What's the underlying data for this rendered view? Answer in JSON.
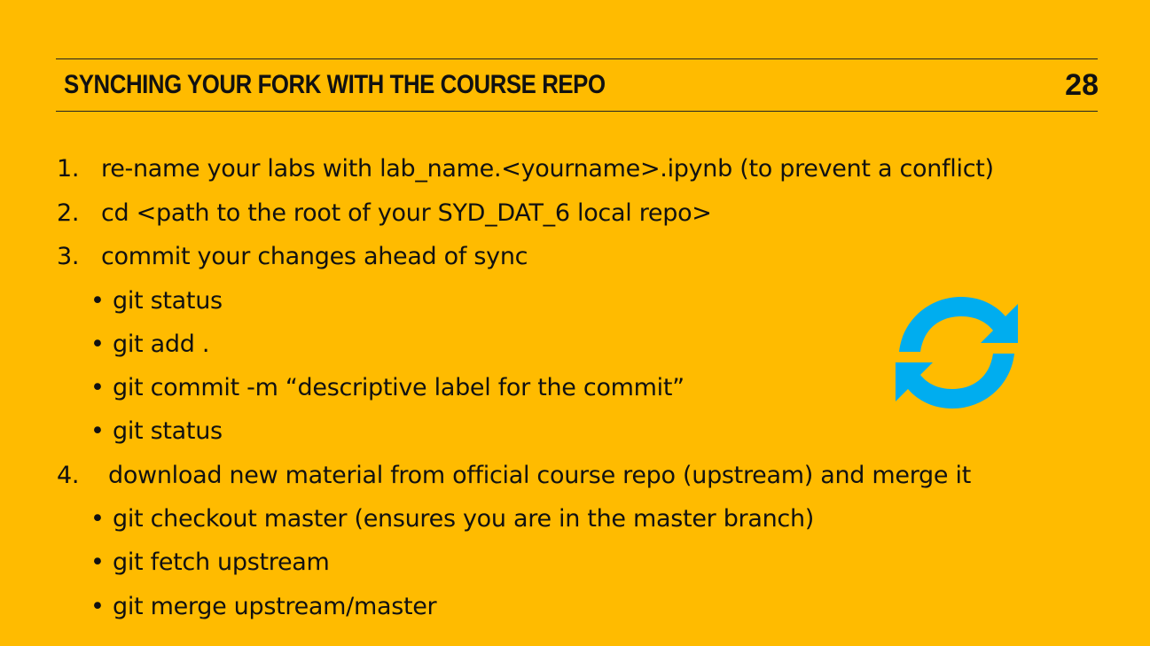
{
  "slide": {
    "title": "SYNCHING YOUR FORK WITH THE COURSE REPO",
    "page_number": "28",
    "background_color": "#FFBB00",
    "icon": "sync-icon",
    "icon_color": "#00ADEF"
  },
  "steps": [
    {
      "number": "1.",
      "text": "re-name your labs with lab_name.<yourname>.ipynb  (to prevent a conflict)"
    },
    {
      "number": "2.",
      "text": "cd <path to the root of your SYD_DAT_6 local repo>"
    },
    {
      "number": "3.",
      "text": "commit your changes ahead of sync",
      "substeps": [
        "git status",
        "git add .",
        "git commit -m “descriptive label for the commit”",
        "git status"
      ]
    },
    {
      "number": "4.",
      "text": "download new material from official course repo (upstream) and merge it",
      "substeps": [
        "git checkout master  (ensures you are in the master branch)",
        "git fetch upstream",
        "git merge upstream/master"
      ]
    }
  ],
  "bullet_glyph": "•"
}
